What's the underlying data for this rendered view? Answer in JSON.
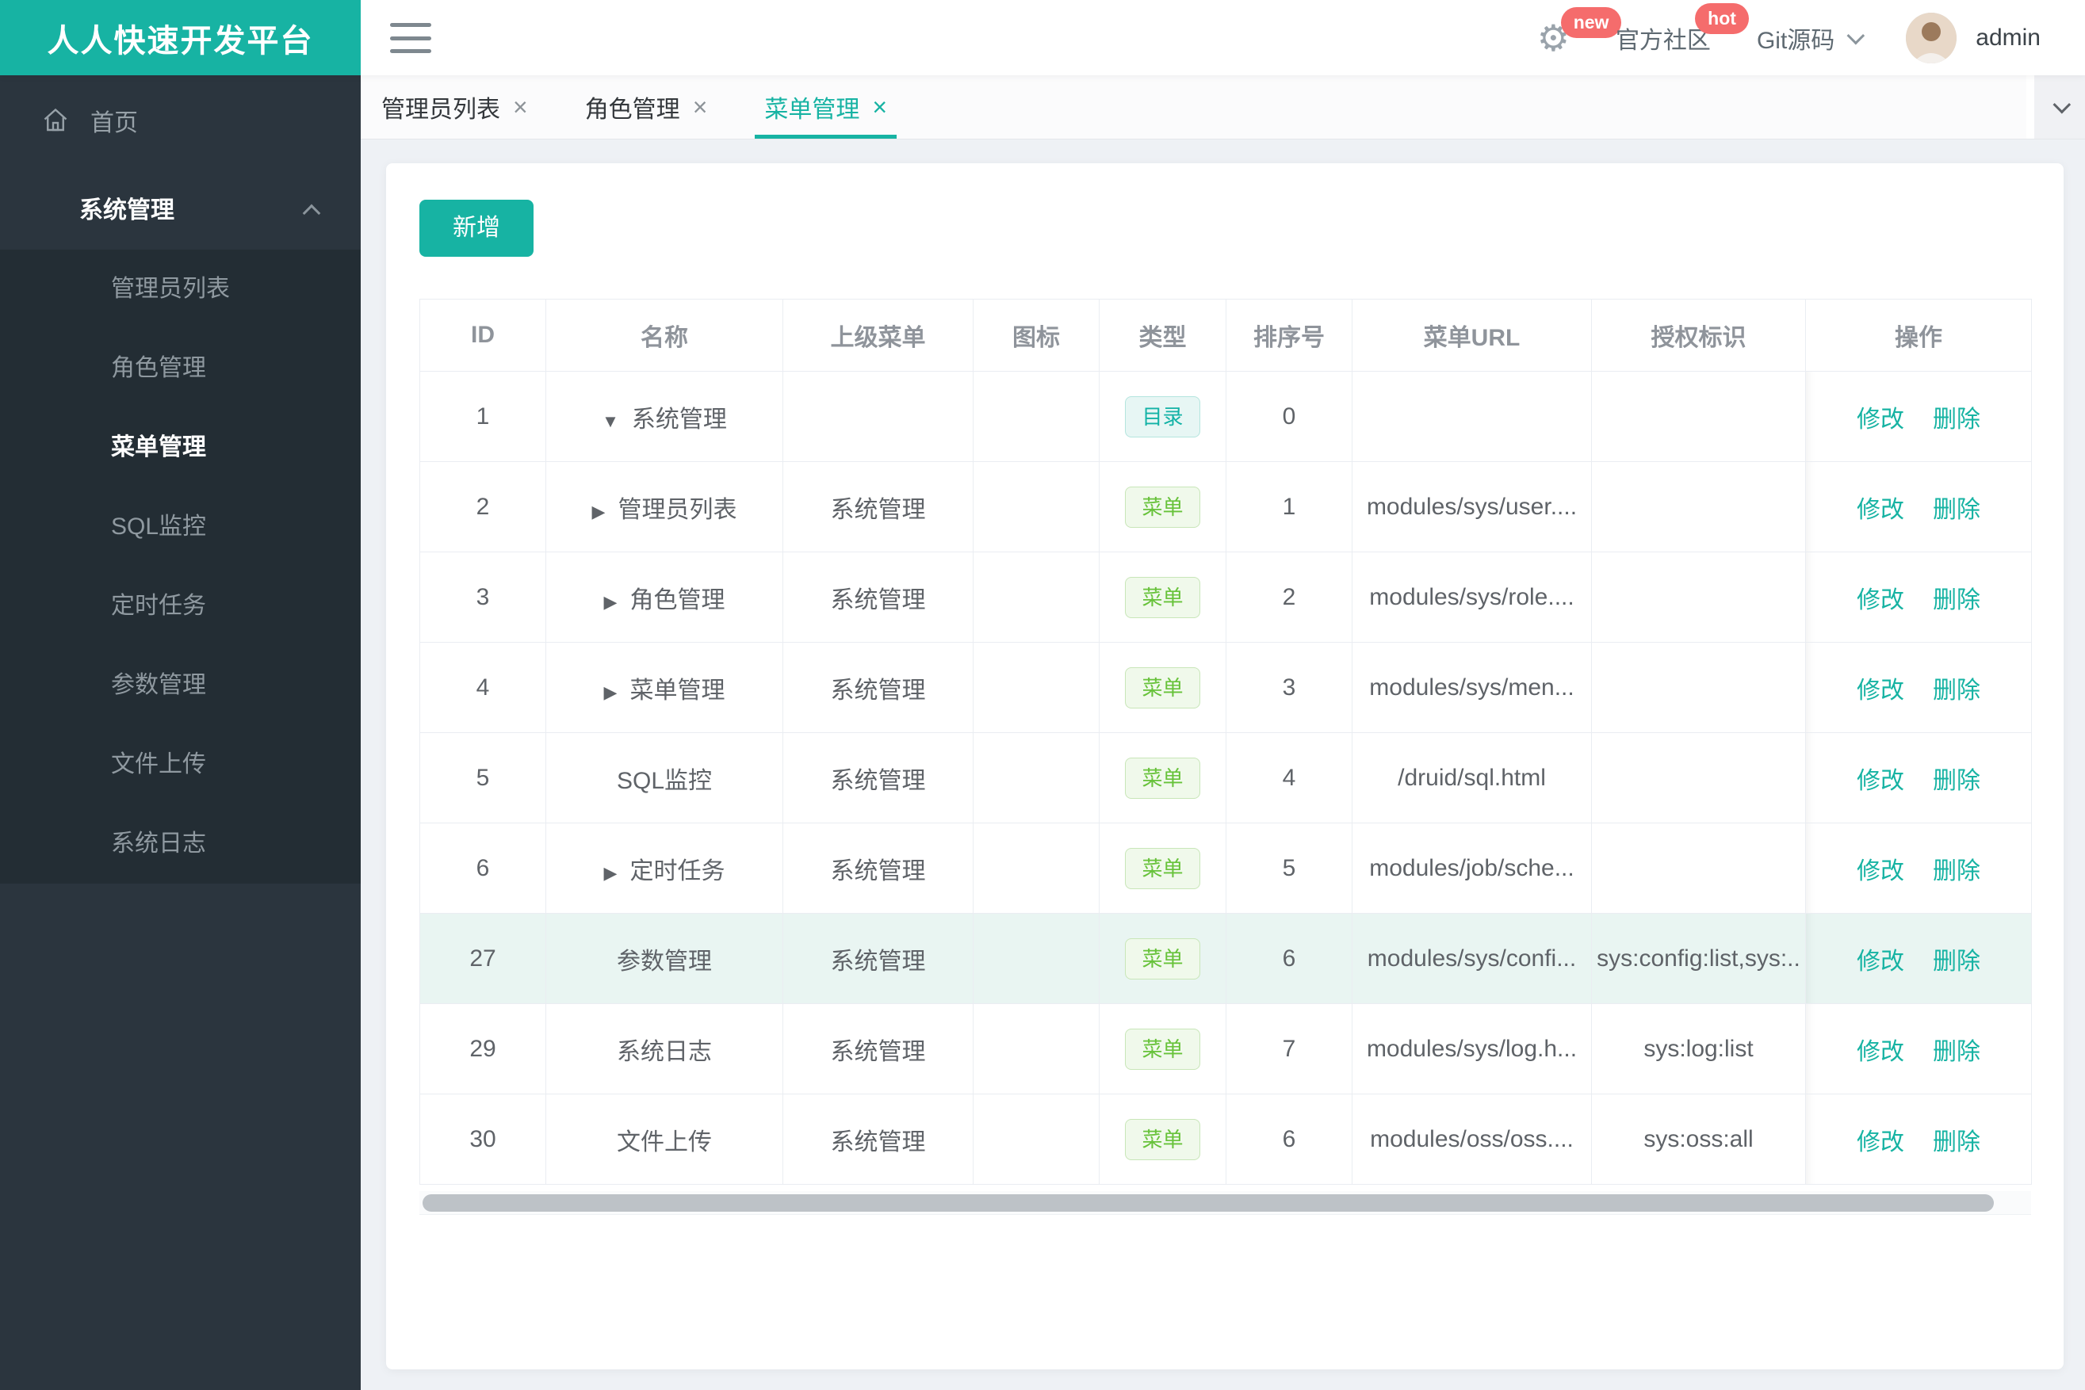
{
  "brand": {
    "title": "人人快速开发平台"
  },
  "topbar": {
    "badge_new": "new",
    "community": "官方社区",
    "badge_hot": "hot",
    "git": "Git源码",
    "username": "admin"
  },
  "sidebar": {
    "home": "首页",
    "group": "系统管理",
    "items": [
      "管理员列表",
      "角色管理",
      "菜单管理",
      "SQL监控",
      "定时任务",
      "参数管理",
      "文件上传",
      "系统日志"
    ],
    "active_index": 2
  },
  "tabs": {
    "close_glyph": "×",
    "items": [
      {
        "label": "管理员列表",
        "active": false
      },
      {
        "label": "角色管理",
        "active": false
      },
      {
        "label": "菜单管理",
        "active": true
      }
    ]
  },
  "toolbar": {
    "add_label": "新增"
  },
  "table": {
    "headers": [
      "ID",
      "名称",
      "上级菜单",
      "图标",
      "类型",
      "排序号",
      "菜单URL",
      "授权标识",
      "操作"
    ],
    "tags": {
      "dir": "目录",
      "menu": "菜单"
    },
    "actions": {
      "edit": "修改",
      "delete": "删除"
    },
    "rows": [
      {
        "id": "1",
        "arrow": "down",
        "name": "系统管理",
        "parent": "",
        "icon": "",
        "type": "dir",
        "order": "0",
        "url": "",
        "perms": "",
        "highlight": false
      },
      {
        "id": "2",
        "arrow": "right",
        "name": "管理员列表",
        "parent": "系统管理",
        "icon": "",
        "type": "menu",
        "order": "1",
        "url": "modules/sys/user....",
        "perms": "",
        "highlight": false
      },
      {
        "id": "3",
        "arrow": "right",
        "name": "角色管理",
        "parent": "系统管理",
        "icon": "",
        "type": "menu",
        "order": "2",
        "url": "modules/sys/role....",
        "perms": "",
        "highlight": false
      },
      {
        "id": "4",
        "arrow": "right",
        "name": "菜单管理",
        "parent": "系统管理",
        "icon": "",
        "type": "menu",
        "order": "3",
        "url": "modules/sys/men...",
        "perms": "",
        "highlight": false
      },
      {
        "id": "5",
        "arrow": "none",
        "name": "SQL监控",
        "parent": "系统管理",
        "icon": "",
        "type": "menu",
        "order": "4",
        "url": "/druid/sql.html",
        "perms": "",
        "highlight": false
      },
      {
        "id": "6",
        "arrow": "right",
        "name": "定时任务",
        "parent": "系统管理",
        "icon": "",
        "type": "menu",
        "order": "5",
        "url": "modules/job/sche...",
        "perms": "",
        "highlight": false
      },
      {
        "id": "27",
        "arrow": "none",
        "name": "参数管理",
        "parent": "系统管理",
        "icon": "",
        "type": "menu",
        "order": "6",
        "url": "modules/sys/confi...",
        "perms": "sys:config:list,sys:..",
        "highlight": true
      },
      {
        "id": "29",
        "arrow": "none",
        "name": "系统日志",
        "parent": "系统管理",
        "icon": "",
        "type": "menu",
        "order": "7",
        "url": "modules/sys/log.h...",
        "perms": "sys:log:list",
        "highlight": false
      },
      {
        "id": "30",
        "arrow": "none",
        "name": "文件上传",
        "parent": "系统管理",
        "icon": "",
        "type": "menu",
        "order": "6",
        "url": "modules/oss/oss....",
        "perms": "sys:oss:all",
        "highlight": false
      }
    ]
  },
  "colors": {
    "accent": "#17b3a3",
    "badge_red": "#f56c6c",
    "tag_dir_text": "#13b2a6",
    "tag_menu_text": "#67c23a",
    "sidebar_base": "#2b353e",
    "sidebar_submenu": "#232d34",
    "row_highlight": "#e9f5f2"
  }
}
